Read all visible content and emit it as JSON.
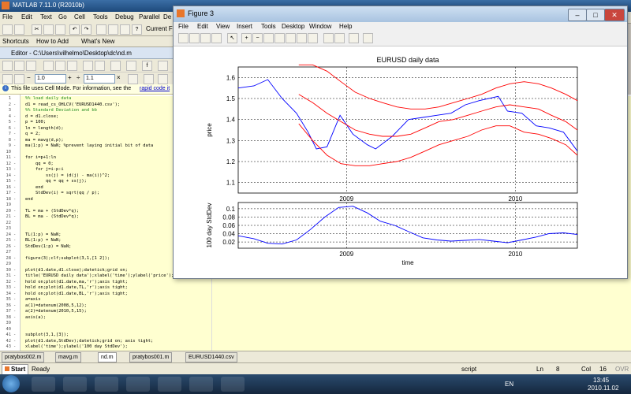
{
  "matlab": {
    "title": "MATLAB 7.11.0 (R2010b)",
    "menus": [
      "File",
      "Edit",
      "Text",
      "Go",
      "Cell",
      "Tools",
      "Debug",
      "Parallel",
      "De"
    ],
    "current_folder_label": "Current F",
    "shortcuts": [
      "Shortcuts",
      "How to Add",
      "What's New"
    ],
    "editor_title": "Editor - C:\\Users\\vilhelmo\\Desktop\\dc\\nd.m",
    "zoom_value": "1.0",
    "step_value": "1.1",
    "cell_info": "This file uses Cell Mode. For information, see the",
    "cell_info_link": "rapid code it",
    "code_lines": [
      {
        "n": "1",
        "t": "%% load daily data",
        "dash": false,
        "cell": true
      },
      {
        "n": "2",
        "t": "d1 = read_cs_OHLCV('EURUSD1440.csv');",
        "dash": true,
        "cell": true
      },
      {
        "n": "3",
        "t": "%% Standard Deviation and bb",
        "dash": false,
        "cell": true
      },
      {
        "n": "4",
        "t": "d = d1.close;",
        "dash": true,
        "cell": true
      },
      {
        "n": "5",
        "t": "p = 100;",
        "dash": true,
        "cell": true
      },
      {
        "n": "6",
        "t": "ln = length(d);",
        "dash": true,
        "cell": true
      },
      {
        "n": "7",
        "t": "q = 2;",
        "dash": true,
        "cell": true
      },
      {
        "n": "8",
        "t": "ma = mavg(d,p);",
        "dash": true,
        "cell": true
      },
      {
        "n": "9",
        "t": "ma(1:p) = NaN; %prevent laying initial bit of data",
        "dash": true,
        "cell": true
      },
      {
        "n": "10",
        "t": "",
        "dash": false,
        "cell": true
      },
      {
        "n": "11",
        "t": "for i=p+1:ln",
        "dash": true,
        "cell": true
      },
      {
        "n": "12",
        "t": "    qq = 0;",
        "dash": true,
        "cell": true
      },
      {
        "n": "13",
        "t": "    for j=i-p:i",
        "dash": true,
        "cell": true
      },
      {
        "n": "14",
        "t": "        ss(j) = (d(j) - ma(i))^2;",
        "dash": true,
        "cell": true
      },
      {
        "n": "15",
        "t": "        qq = qq + ss(j);",
        "dash": true,
        "cell": true
      },
      {
        "n": "16",
        "t": "    end",
        "dash": true,
        "cell": true
      },
      {
        "n": "17",
        "t": "    StdDev(i) = sqrt(qq / p);",
        "dash": true,
        "cell": true
      },
      {
        "n": "18",
        "t": "end",
        "dash": true,
        "cell": true
      },
      {
        "n": "19",
        "t": "",
        "dash": false,
        "cell": true
      },
      {
        "n": "20",
        "t": "TL = ma + (StdDev*q);",
        "dash": true,
        "cell": true
      },
      {
        "n": "21",
        "t": "BL = ma - (StdDev*q);",
        "dash": true,
        "cell": true
      },
      {
        "n": "22",
        "t": "",
        "dash": false,
        "cell": true
      },
      {
        "n": "23",
        "t": "",
        "dash": false,
        "cell": true
      },
      {
        "n": "24",
        "t": "TL(1:p) = NaN;",
        "dash": true,
        "cell": true
      },
      {
        "n": "25",
        "t": "BL(1:p) = NaN;",
        "dash": true,
        "cell": true
      },
      {
        "n": "26",
        "t": "StdDev(1:p) = NaN;",
        "dash": true,
        "cell": true
      },
      {
        "n": "27",
        "t": "",
        "dash": false,
        "cell": true
      },
      {
        "n": "28",
        "t": "figure(3);clf;subplot(3,1,[1 2]);",
        "dash": true,
        "cell": true
      },
      {
        "n": "29",
        "t": "",
        "dash": false,
        "cell": true
      },
      {
        "n": "30",
        "t": "plot(d1.date,d1.close);datetick;grid on;",
        "dash": true,
        "cell": true
      },
      {
        "n": "31",
        "t": "title('EURUSD daily data');xlabel('time');ylabel('price');",
        "dash": true,
        "cell": true
      },
      {
        "n": "32",
        "t": "hold on;plot(d1.date,ma,'r');axis tight;",
        "dash": true,
        "cell": true
      },
      {
        "n": "33",
        "t": "hold on;plot(d1.date,TL,'r');axis tight;",
        "dash": true,
        "cell": true
      },
      {
        "n": "34",
        "t": "hold on;plot(d1.date,BL,'r');axis tight;",
        "dash": true,
        "cell": true
      },
      {
        "n": "35",
        "t": "a=axis",
        "dash": true,
        "cell": true
      },
      {
        "n": "36",
        "t": "a(1)=datenum(2008,5,12);",
        "dash": true,
        "cell": true
      },
      {
        "n": "37",
        "t": "a(2)=datenum(2010,5,15);",
        "dash": true,
        "cell": true
      },
      {
        "n": "38",
        "t": "axis(a);",
        "dash": true,
        "cell": true
      },
      {
        "n": "39",
        "t": "",
        "dash": false,
        "cell": true
      },
      {
        "n": "40",
        "t": "",
        "dash": false,
        "cell": true
      },
      {
        "n": "41",
        "t": "subplot(3,1,[3]);",
        "dash": true,
        "cell": true
      },
      {
        "n": "42",
        "t": "plot(d1.date,StdDev);datetick;grid on; axis tight;",
        "dash": true,
        "cell": true
      },
      {
        "n": "43",
        "t": "xlabel('time');ylabel('100 day StdDev');",
        "dash": true,
        "cell": true
      }
    ],
    "doc_tabs": [
      "pratybos002.m",
      "mavg.m",
      "nd.m",
      "pratybos001.m",
      "EURUSD1440.csv"
    ],
    "status": {
      "start": "Start",
      "ready": "Ready",
      "mode": "script",
      "ln_label": "Ln",
      "ln": "8",
      "col_label": "Col",
      "col": "16",
      "ovr": "OVR"
    },
    "taskbar": {
      "lang": "EN",
      "time": "13:45",
      "date": "2010.11.02"
    }
  },
  "figure": {
    "title": "Figure 3",
    "menus": [
      "File",
      "Edit",
      "View",
      "Insert",
      "Tools",
      "Desktop",
      "Window",
      "Help"
    ]
  },
  "chart_data": [
    {
      "type": "line",
      "title": "EURUSD daily data",
      "xlabel": "time",
      "ylabel": "price",
      "xlim": [
        "2008-05-12",
        "2010-05-15"
      ],
      "ylim": [
        1.05,
        1.65
      ],
      "yticks": [
        "1.1",
        "1.2",
        "1.3",
        "1.4",
        "1.5",
        "1.6"
      ],
      "xticks": [
        {
          "label": "2009",
          "date": "2009-01-01"
        },
        {
          "label": "2010",
          "date": "2010-01-01"
        }
      ],
      "grid": true,
      "series": [
        {
          "color": "#0000ff",
          "x": [
            "2008-05-12",
            "2008-06-15",
            "2008-07-15",
            "2008-08-15",
            "2008-09-15",
            "2008-10-10",
            "2008-10-28",
            "2008-11-20",
            "2008-12-18",
            "2009-01-15",
            "2009-02-15",
            "2009-03-05",
            "2009-04-10",
            "2009-05-15",
            "2009-06-15",
            "2009-07-15",
            "2009-08-15",
            "2009-09-15",
            "2009-10-15",
            "2009-11-25",
            "2009-12-15",
            "2010-01-15",
            "2010-02-15",
            "2010-03-15",
            "2010-04-15",
            "2010-05-15"
          ],
          "values": [
            1.55,
            1.56,
            1.59,
            1.5,
            1.43,
            1.34,
            1.26,
            1.27,
            1.42,
            1.33,
            1.28,
            1.26,
            1.32,
            1.4,
            1.41,
            1.42,
            1.43,
            1.47,
            1.49,
            1.51,
            1.44,
            1.43,
            1.37,
            1.36,
            1.34,
            1.25
          ]
        },
        {
          "color": "#ff0000",
          "x": [
            "2008-09-20",
            "2008-10-20",
            "2008-11-20",
            "2008-12-20",
            "2009-01-20",
            "2009-02-20",
            "2009-03-20",
            "2009-04-20",
            "2009-05-20",
            "2009-06-20",
            "2009-07-20",
            "2009-08-20",
            "2009-09-20",
            "2009-10-20",
            "2009-11-20",
            "2009-12-20",
            "2010-01-20",
            "2010-02-20",
            "2010-03-20",
            "2010-04-20",
            "2010-05-15"
          ],
          "values": [
            1.52,
            1.48,
            1.43,
            1.39,
            1.35,
            1.33,
            1.32,
            1.32,
            1.33,
            1.36,
            1.39,
            1.4,
            1.42,
            1.44,
            1.46,
            1.47,
            1.46,
            1.45,
            1.42,
            1.39,
            1.35
          ]
        },
        {
          "color": "#ff0000",
          "x": [
            "2008-09-20",
            "2008-10-20",
            "2008-11-20",
            "2008-12-20",
            "2009-01-20",
            "2009-02-20",
            "2009-03-20",
            "2009-04-20",
            "2009-05-20",
            "2009-06-20",
            "2009-07-20",
            "2009-08-20",
            "2009-09-20",
            "2009-10-20",
            "2009-11-20",
            "2009-12-20",
            "2010-01-20",
            "2010-02-20",
            "2010-03-20",
            "2010-04-20",
            "2010-05-15"
          ],
          "values": [
            1.66,
            1.66,
            1.63,
            1.58,
            1.53,
            1.5,
            1.48,
            1.46,
            1.45,
            1.45,
            1.46,
            1.48,
            1.5,
            1.52,
            1.55,
            1.57,
            1.58,
            1.57,
            1.55,
            1.52,
            1.49
          ]
        },
        {
          "color": "#ff0000",
          "x": [
            "2008-09-20",
            "2008-10-20",
            "2008-11-20",
            "2008-12-20",
            "2009-01-20",
            "2009-02-20",
            "2009-03-20",
            "2009-04-20",
            "2009-05-20",
            "2009-06-20",
            "2009-07-20",
            "2009-08-20",
            "2009-09-20",
            "2009-10-20",
            "2009-11-20",
            "2009-12-20",
            "2010-01-20",
            "2010-02-20",
            "2010-03-20",
            "2010-04-20",
            "2010-05-15"
          ],
          "values": [
            1.38,
            1.3,
            1.23,
            1.19,
            1.18,
            1.18,
            1.19,
            1.2,
            1.22,
            1.25,
            1.28,
            1.3,
            1.32,
            1.35,
            1.37,
            1.37,
            1.34,
            1.33,
            1.31,
            1.28,
            1.23
          ]
        }
      ]
    },
    {
      "type": "line",
      "title": "",
      "xlabel": "time",
      "ylabel": "100 day StdDev",
      "xlim": [
        "2008-05-12",
        "2010-05-15"
      ],
      "ylim": [
        0.005,
        0.115
      ],
      "yticks": [
        "0.02",
        "0.04",
        "0.06",
        "0.08",
        "0.1"
      ],
      "xticks": [
        {
          "label": "2009",
          "date": "2009-01-01"
        },
        {
          "label": "2010",
          "date": "2010-01-01"
        }
      ],
      "grid": true,
      "series": [
        {
          "color": "#0000ff",
          "x": [
            "2008-05-12",
            "2008-06-15",
            "2008-07-15",
            "2008-08-15",
            "2008-09-15",
            "2008-10-15",
            "2008-11-15",
            "2008-12-15",
            "2009-01-15",
            "2009-02-15",
            "2009-03-15",
            "2009-04-15",
            "2009-05-15",
            "2009-06-15",
            "2009-07-15",
            "2009-08-15",
            "2009-09-15",
            "2009-10-15",
            "2009-11-15",
            "2009-12-15",
            "2010-01-15",
            "2010-02-15",
            "2010-03-15",
            "2010-04-15",
            "2010-05-15"
          ],
          "values": [
            0.035,
            0.028,
            0.017,
            0.015,
            0.025,
            0.05,
            0.08,
            0.103,
            0.106,
            0.09,
            0.07,
            0.06,
            0.045,
            0.03,
            0.025,
            0.022,
            0.024,
            0.026,
            0.022,
            0.018,
            0.025,
            0.032,
            0.04,
            0.042,
            0.038
          ]
        }
      ]
    }
  ]
}
